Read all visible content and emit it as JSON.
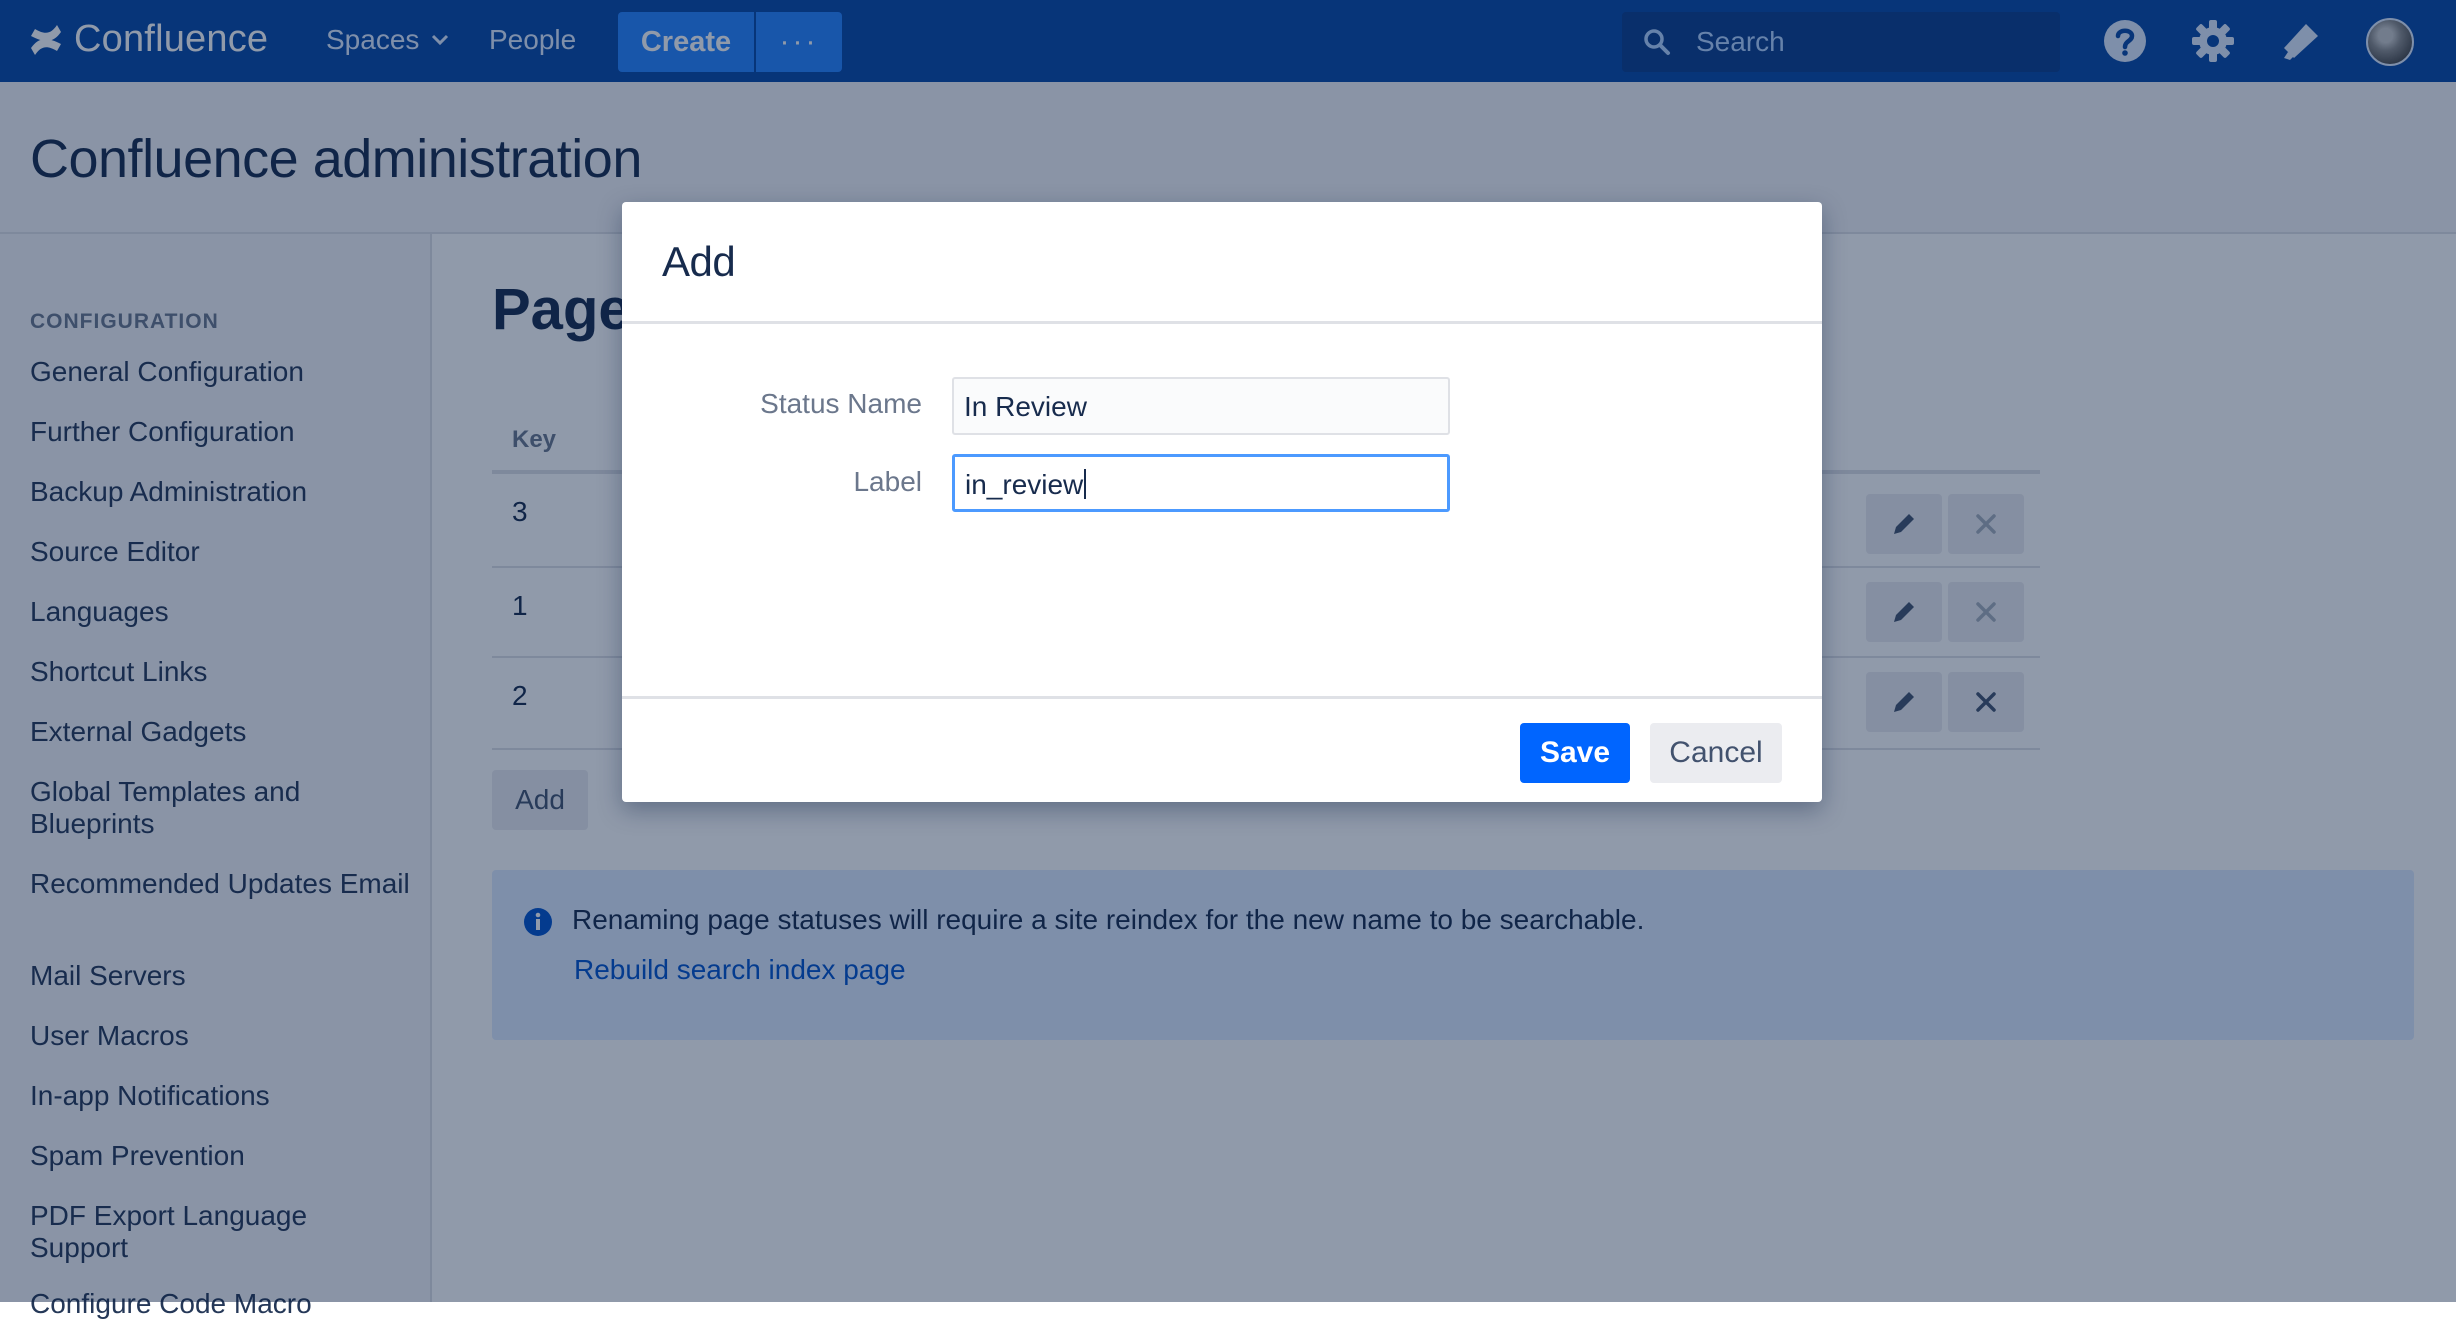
{
  "topnav": {
    "brand": "Confluence",
    "spaces_label": "Spaces",
    "people_label": "People",
    "create_label": "Create",
    "more_label": "···",
    "search_placeholder": "Search",
    "bg_color": "#0747A6"
  },
  "header": {
    "title": "Confluence administration"
  },
  "sidebar": {
    "section_heading": "CONFIGURATION",
    "items": [
      {
        "label": "General Configuration"
      },
      {
        "label": "Further Configuration"
      },
      {
        "label": "Backup Administration"
      },
      {
        "label": "Source Editor"
      },
      {
        "label": "Languages"
      },
      {
        "label": "Shortcut Links"
      },
      {
        "label": "External Gadgets"
      },
      {
        "label": "Global Templates and Blueprints"
      },
      {
        "label": "Recommended Updates Email"
      },
      {
        "label": "Mail Servers"
      },
      {
        "label": "User Macros"
      },
      {
        "label": "In-app Notifications"
      },
      {
        "label": "Spam Prevention"
      },
      {
        "label": "PDF Export Language Support"
      },
      {
        "label": "Configure Code Macro"
      }
    ]
  },
  "main": {
    "title_partial": "Page",
    "table": {
      "key_header": "Key",
      "rows": [
        {
          "key": "3"
        },
        {
          "key": "1"
        },
        {
          "key": "2"
        }
      ]
    },
    "add_label": "Add",
    "info": {
      "message": "Renaming page statuses will require a site reindex for the new name to be searchable.",
      "link": "Rebuild search index page"
    }
  },
  "dialog": {
    "title": "Add",
    "status_name_label": "Status Name",
    "status_name_value": "In Review",
    "label_label": "Label",
    "label_value": "in_review",
    "save_label": "Save",
    "cancel_label": "Cancel",
    "accent_color": "#0065FF"
  }
}
